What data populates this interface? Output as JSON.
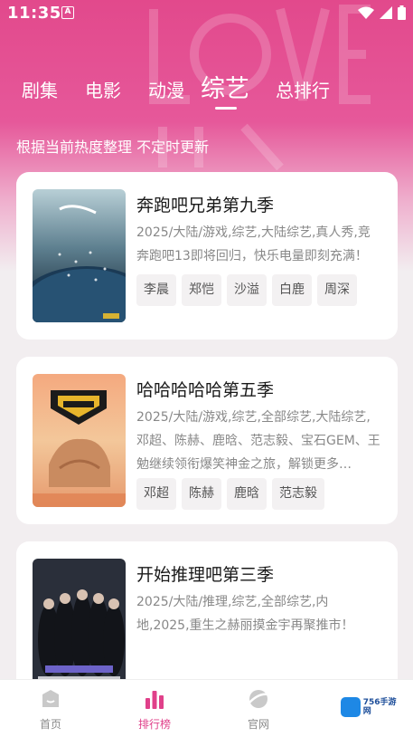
{
  "status": {
    "time": "11:35",
    "app_icon_letter": "A"
  },
  "tabs": [
    {
      "label": "剧集",
      "active": false
    },
    {
      "label": "电影",
      "active": false
    },
    {
      "label": "动漫",
      "active": false
    },
    {
      "label": "综艺",
      "active": true
    },
    {
      "label": "总排行",
      "active": false
    }
  ],
  "subtitle": "根据当前热度整理 不定时更新",
  "cards": [
    {
      "title": "奔跑吧兄弟第九季",
      "desc": "2025/大陆/游戏,综艺,大陆综艺,真人秀,竞奔跑吧13即将回归，快乐电量即刻充满！",
      "tags": [
        "李晨",
        "郑恺",
        "沙溢",
        "白鹿",
        "周深"
      ]
    },
    {
      "title": "哈哈哈哈哈第五季",
      "desc": "2025/大陆/游戏,综艺,全部综艺,大陆综艺,邓超、陈赫、鹿晗、范志毅、宝石GEM、王勉继续领衔爆笑神金之旅，解锁更多…",
      "tags": [
        "邓超",
        "陈赫",
        "鹿晗",
        "范志毅"
      ]
    },
    {
      "title": "开始推理吧第三季",
      "desc": "2025/大陆/推理,综艺,全部综艺,内地,2025,重生之赫丽摸金宇再聚推市！",
      "tags": []
    }
  ],
  "bottom_nav": [
    {
      "label": "首页",
      "icon": "home-icon",
      "active": false
    },
    {
      "label": "排行榜",
      "icon": "ranking-icon",
      "active": true
    },
    {
      "label": "官网",
      "icon": "website-icon",
      "active": false
    }
  ],
  "watermark_brand": "756手游网",
  "colors": {
    "accent": "#e0408a",
    "header": "#e2498c"
  }
}
